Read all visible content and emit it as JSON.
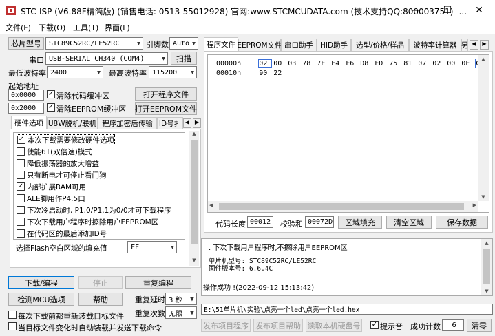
{
  "window": {
    "title": "STC-ISP (V6.88F精简版) (销售电话: 0513-55012928) 官网:www.STCMCUDATA.com (技术支持QQ:800003751) -...",
    "minimize": "—",
    "maximize": "☐",
    "close": "✕"
  },
  "menu": [
    "文件(F)",
    "下载(O)",
    "工具(T)",
    "界面(L)"
  ],
  "chip": {
    "label": "芯片型号",
    "value": "STC89C52RC/LE52RC",
    "pin_label": "引脚数",
    "pin_value": "Auto"
  },
  "port": {
    "label": "串口",
    "value": "USB-SERIAL CH340 (COM4)",
    "scan": "扫描"
  },
  "baud": {
    "min_label": "最低波特率",
    "min_value": "2400",
    "max_label": "最高波特率",
    "max_value": "115200"
  },
  "start_addr": {
    "label": "起始地址",
    "code_addr": "0x0000",
    "clear_code": "清除代码缓冲区",
    "open_prog": "打开程序文件",
    "eeprom_addr": "0x2000",
    "clear_eeprom": "清除EEPROM缓冲区",
    "open_eeprom": "打开EEPROM文件"
  },
  "left_tabs": [
    "硬件选项",
    "U8W脱机/联机",
    "程序加密后传输",
    "ID号扌"
  ],
  "hw_options": [
    {
      "label": "本次下载需要修改硬件选项",
      "checked": "✓"
    },
    {
      "label": "使能6T(双倍速)模式",
      "checked": ""
    },
    {
      "label": "降低振荡器的放大增益",
      "checked": ""
    },
    {
      "label": "只有断电才可停止看门狗",
      "checked": ""
    },
    {
      "label": "内部扩展RAM可用",
      "checked": "✓"
    },
    {
      "label": "ALE脚用作P4.5口",
      "checked": ""
    },
    {
      "label": "下次冷启动时, P1.0/P1.1为0/0才可下载程序",
      "checked": ""
    },
    {
      "label": "下次下载用户程序时擦除用户EEPROM区",
      "checked": ""
    },
    {
      "label": "在代码区的最后添加ID号",
      "checked": ""
    }
  ],
  "flash_fill": {
    "label": "选择Flash空白区域的填充值",
    "value": "FF"
  },
  "actions": {
    "download": "下载/编程",
    "stop": "停止",
    "reprogram": "重复编程",
    "check_mcu": "检测MCU选项",
    "help": "帮助",
    "repeat_delay_label": "重复延时",
    "repeat_delay_value": "3 秒",
    "repeat_count_label": "重复次数",
    "repeat_count_value": "无限",
    "reload_each": "每次下载前都重新装载目标文件",
    "auto_reload": "当目标文件变化时自动装载并发送下载命令"
  },
  "right_tabs": [
    "程序文件",
    "EEPROM文件",
    "串口助手",
    "HID助手",
    "选型/价格/样品",
    "波特率计算器",
    "另"
  ],
  "hex": {
    "rows": [
      {
        "addr": "00000h",
        "bytes": [
          "02",
          "00",
          "03",
          "78",
          "7F",
          "E4",
          "F6",
          "D8",
          "FD",
          "75",
          "81",
          "07",
          "02",
          "00",
          "0F",
          "C2"
        ]
      },
      {
        "addr": "00010h",
        "bytes": [
          "90",
          "22"
        ]
      }
    ]
  },
  "code_info": {
    "len_label": "代码长度",
    "len_value": "00012",
    "checksum_label": "校验和",
    "checksum_value": "00072D",
    "fill_btn": "区域填充",
    "clear_btn": "清空区域",
    "save_btn": "保存数据"
  },
  "log": {
    "line1": ". 下次下载用户程序时,不擦除用户EEPROM区",
    "line2": "单片机型号: STC89C52RC/LE52RC",
    "line3": "固件版本号: 6.6.4C",
    "line4": "操作成功 !(2022-09-12 15:13:42)"
  },
  "file_path": "E:\\51单片机\\实验\\点亮一个led\\点亮一个led.hex",
  "bottom": {
    "publish_prog": "发布项目程序",
    "publish_help": "发布项目帮助",
    "read_serial": "读取本机硬盘号",
    "beep_label": "提示音",
    "success_label": "成功计数",
    "success_value": "6",
    "clear": "清零"
  },
  "colors": {
    "selected_byte_border": "#3a6fd8",
    "accent": "#0078d7"
  }
}
